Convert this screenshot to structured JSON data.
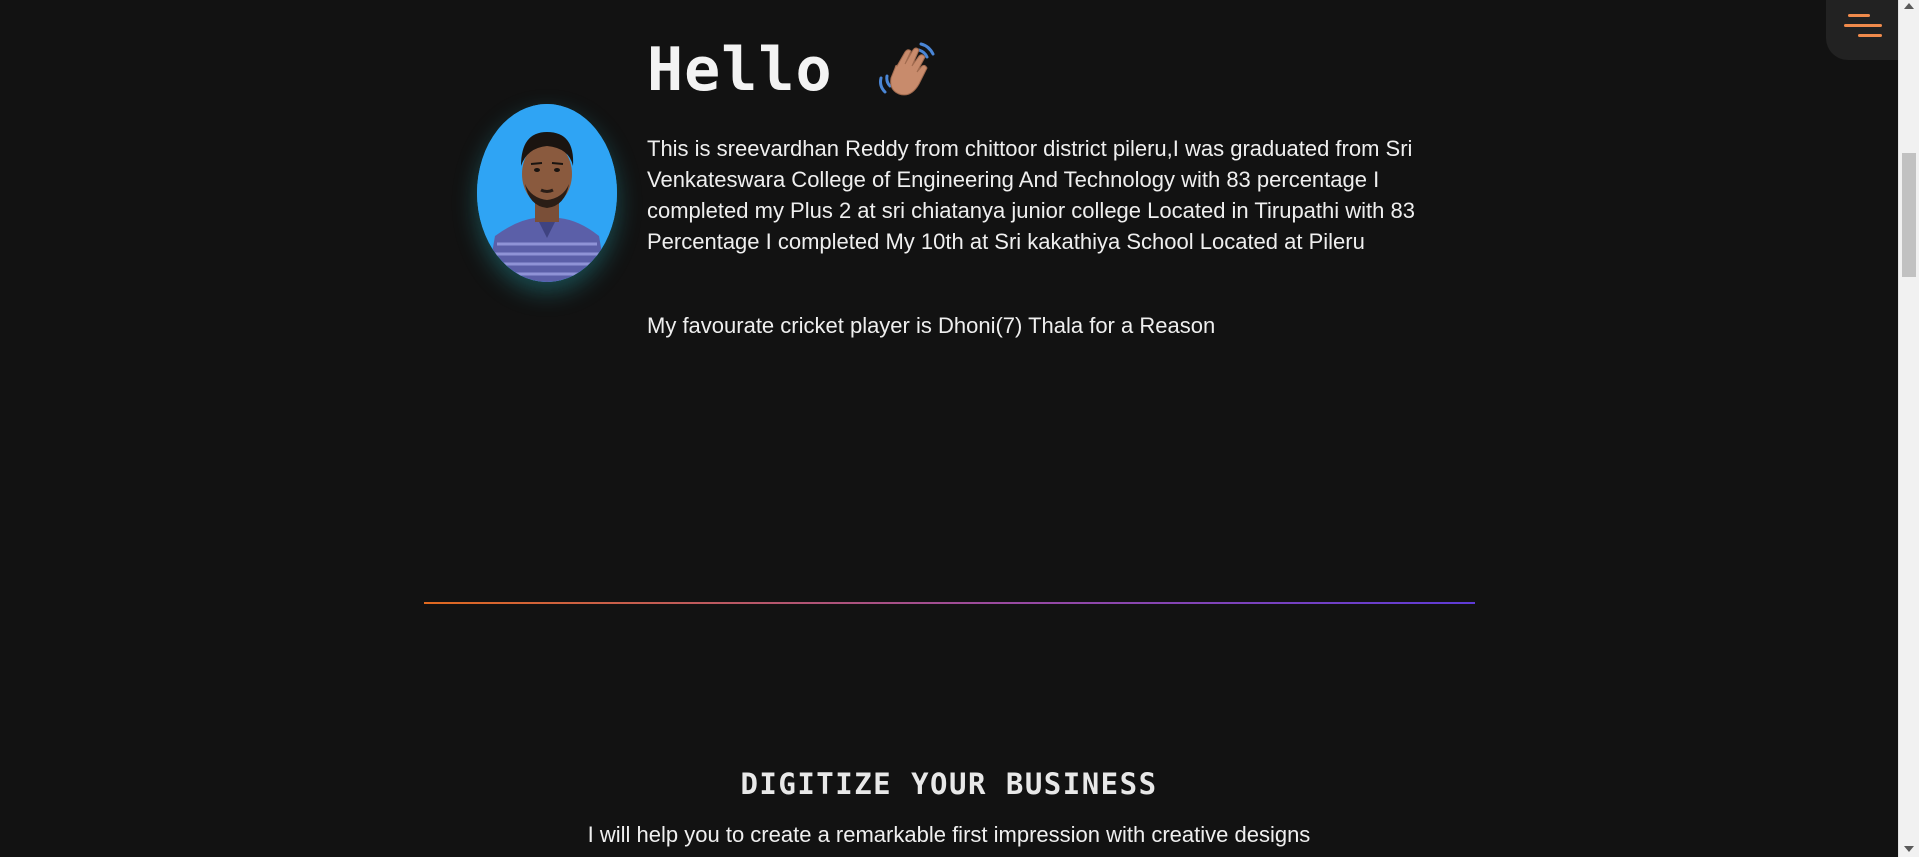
{
  "hero": {
    "title": "Hello",
    "wave_icon": "waving-hand-icon",
    "bio": "This is sreevardhan Reddy from chittoor district pileru,I was graduated from Sri Venkateswara College of Engineering And Technology with 83 percentage I completed my Plus 2 at sri chiatanya junior college Located in Tirupathi with 83 Percentage I completed My 10th at Sri kakathiya School Located at Pileru",
    "favourite": "My favourate cricket player is Dhoni(7) Thala for a Reason"
  },
  "services": {
    "title": "DIGITIZE YOUR BUSINESS",
    "subtitle": "I will help you to create a remarkable first impression with creative designs"
  },
  "menu": {
    "icon": "hamburger-menu-icon"
  },
  "colors": {
    "background": "#121212",
    "menu_accent": "#f08a4b",
    "avatar_bg": "#2fa4f4",
    "divider_start": "#e0691f",
    "divider_end": "#5e3bd6"
  }
}
